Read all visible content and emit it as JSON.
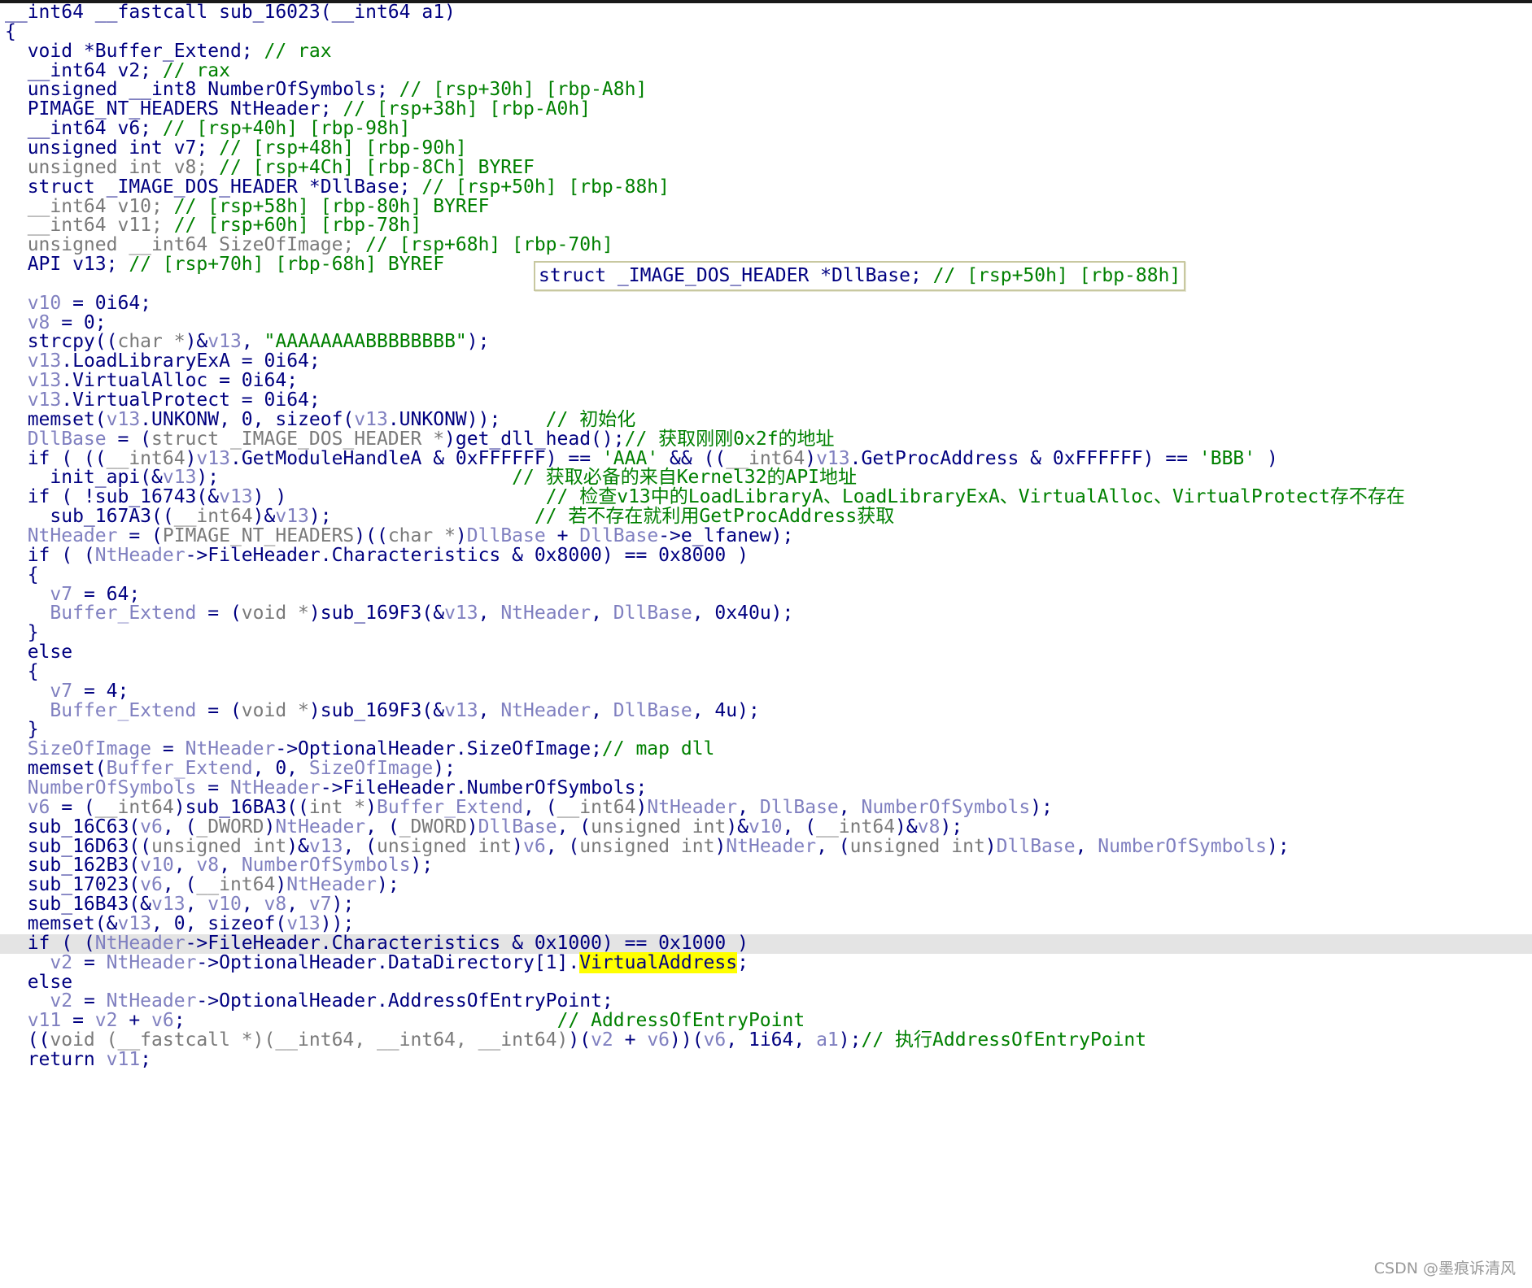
{
  "editor": {
    "current_line_index": 48,
    "lines": [
      [
        [
          "k",
          "__int64 __fastcall sub_16023(__int64 a1)"
        ]
      ],
      [
        [
          "p",
          "{"
        ]
      ],
      [
        [
          "k",
          "  void *Buffer_Extend; "
        ],
        [
          "c",
          "// rax"
        ]
      ],
      [
        [
          "k",
          "  __int64 v2; "
        ],
        [
          "c",
          "// rax"
        ]
      ],
      [
        [
          "k",
          "  unsigned __int8 NumberOfSymbols; "
        ],
        [
          "c",
          "// [rsp+30h] [rbp-A8h]"
        ]
      ],
      [
        [
          "k",
          "  PIMAGE_NT_HEADERS NtHeader; "
        ],
        [
          "c",
          "// [rsp+38h] [rbp-A0h]"
        ]
      ],
      [
        [
          "k",
          "  __int64 v6; "
        ],
        [
          "c",
          "// [rsp+40h] [rbp-98h]"
        ]
      ],
      [
        [
          "k",
          "  unsigned int v7; "
        ],
        [
          "c",
          "// [rsp+48h] [rbp-90h]"
        ]
      ],
      [
        [
          "t",
          "  unsigned int v8; "
        ],
        [
          "c",
          "// [rsp+4Ch] [rbp-8Ch] BYREF"
        ]
      ],
      [
        [
          "k",
          "  struct _IMAGE_DOS_HEADER *DllBase; "
        ],
        [
          "c",
          "// [rsp+50h] [rbp-88h]"
        ]
      ],
      [
        [
          "t",
          "  __int64 v10; "
        ],
        [
          "c",
          "// [rsp+58h] [rbp-80h] BYREF"
        ]
      ],
      [
        [
          "t",
          "  __int64 v11; "
        ],
        [
          "c",
          "// [rsp+60h] [rbp-78h]"
        ]
      ],
      [
        [
          "t",
          "  unsigned __int64 SizeOfImage; "
        ],
        [
          "c",
          "// [rsp+68h] [rbp-70h]"
        ]
      ],
      [
        [
          "k",
          "  API v13; "
        ],
        [
          "c",
          "// [rsp+70h] [rbp-68h] BYREF"
        ]
      ],
      [],
      [
        [
          "v",
          "  v10"
        ],
        [
          "p",
          " = 0i64;"
        ]
      ],
      [
        [
          "v",
          "  v8"
        ],
        [
          "p",
          " = 0;"
        ]
      ],
      [
        [
          "n",
          "  strcpy(("
        ],
        [
          "t",
          "char *"
        ],
        [
          "p",
          ")&"
        ],
        [
          "v",
          "v13"
        ],
        [
          "p",
          ", "
        ],
        [
          "s",
          "\"AAAAAAAABBBBBBBB\""
        ],
        [
          "p",
          ");"
        ]
      ],
      [
        [
          "v",
          "  v13"
        ],
        [
          "p",
          ".LoadLibraryExA = 0i64;"
        ]
      ],
      [
        [
          "v",
          "  v13"
        ],
        [
          "p",
          ".VirtualAlloc = 0i64;"
        ]
      ],
      [
        [
          "v",
          "  v13"
        ],
        [
          "p",
          ".VirtualProtect = 0i64;"
        ]
      ],
      [
        [
          "n",
          "  memset("
        ],
        [
          "v",
          "v13"
        ],
        [
          "p",
          ".UNKONW, 0, sizeof("
        ],
        [
          "v",
          "v13"
        ],
        [
          "p",
          ".UNKONW));    "
        ],
        [
          "c",
          "// 初始化"
        ]
      ],
      [
        [
          "v",
          "  DllBase"
        ],
        [
          "p",
          " = ("
        ],
        [
          "t",
          "struct _IMAGE_DOS_HEADER *"
        ],
        [
          "p",
          ")get_dll_head();"
        ],
        [
          "c",
          "// 获取刚刚0x2f的地址"
        ]
      ],
      [
        [
          "k",
          "  if ( (("
        ],
        [
          "t",
          "__int64"
        ],
        [
          "p",
          ")"
        ],
        [
          "v",
          "v13"
        ],
        [
          "p",
          ".GetModuleHandleA & 0xFFFFFF) == "
        ],
        [
          "s",
          "'AAA'"
        ],
        [
          "p",
          " && (("
        ],
        [
          "t",
          "__int64"
        ],
        [
          "p",
          ")"
        ],
        [
          "v",
          "v13"
        ],
        [
          "p",
          ".GetProcAddress & 0xFFFFFF) == "
        ],
        [
          "s",
          "'BBB'"
        ],
        [
          "p",
          " )"
        ]
      ],
      [
        [
          "n",
          "    init_api(&"
        ],
        [
          "v",
          "v13"
        ],
        [
          "p",
          ");                          "
        ],
        [
          "c",
          "// 获取必备的来自Kernel32的API地址"
        ]
      ],
      [
        [
          "k",
          "  if ( !sub_16743(&"
        ],
        [
          "v",
          "v13"
        ],
        [
          "p",
          ") )                       "
        ],
        [
          "c",
          "// 检查v13中的LoadLibraryA、LoadLibraryExA、VirtualAlloc、VirtualProtect存不存在"
        ]
      ],
      [
        [
          "n",
          "    sub_167A3(("
        ],
        [
          "t",
          "__int64"
        ],
        [
          "p",
          ")&"
        ],
        [
          "v",
          "v13"
        ],
        [
          "p",
          ");                  "
        ],
        [
          "c",
          "// 若不存在就利用GetProcAddress获取"
        ]
      ],
      [
        [
          "v",
          "  NtHeader"
        ],
        [
          "p",
          " = ("
        ],
        [
          "t",
          "PIMAGE_NT_HEADERS"
        ],
        [
          "p",
          ")(("
        ],
        [
          "t",
          "char *"
        ],
        [
          "p",
          ")"
        ],
        [
          "v",
          "DllBase"
        ],
        [
          "p",
          " + "
        ],
        [
          "v",
          "DllBase"
        ],
        [
          "p",
          "->e_lfanew);"
        ]
      ],
      [
        [
          "k",
          "  if ( ("
        ],
        [
          "v",
          "NtHeader"
        ],
        [
          "p",
          "->FileHeader.Characteristics & 0x8000) == 0x8000 )"
        ]
      ],
      [
        [
          "p",
          "  {"
        ]
      ],
      [
        [
          "v",
          "    v7"
        ],
        [
          "p",
          " = 64;"
        ]
      ],
      [
        [
          "v",
          "    Buffer_Extend"
        ],
        [
          "p",
          " = ("
        ],
        [
          "t",
          "void *"
        ],
        [
          "p",
          ")sub_169F3(&"
        ],
        [
          "v",
          "v13"
        ],
        [
          "p",
          ", "
        ],
        [
          "v",
          "NtHeader"
        ],
        [
          "p",
          ", "
        ],
        [
          "v",
          "DllBase"
        ],
        [
          "p",
          ", 0x40u);"
        ]
      ],
      [
        [
          "p",
          "  }"
        ]
      ],
      [
        [
          "k",
          "  else"
        ]
      ],
      [
        [
          "p",
          "  {"
        ]
      ],
      [
        [
          "v",
          "    v7"
        ],
        [
          "p",
          " = 4;"
        ]
      ],
      [
        [
          "v",
          "    Buffer_Extend"
        ],
        [
          "p",
          " = ("
        ],
        [
          "t",
          "void *"
        ],
        [
          "p",
          ")sub_169F3(&"
        ],
        [
          "v",
          "v13"
        ],
        [
          "p",
          ", "
        ],
        [
          "v",
          "NtHeader"
        ],
        [
          "p",
          ", "
        ],
        [
          "v",
          "DllBase"
        ],
        [
          "p",
          ", 4u);"
        ]
      ],
      [
        [
          "p",
          "  }"
        ]
      ],
      [
        [
          "v",
          "  SizeOfImage"
        ],
        [
          "p",
          " = "
        ],
        [
          "v",
          "NtHeader"
        ],
        [
          "p",
          "->OptionalHeader.SizeOfImage;"
        ],
        [
          "c",
          "// map dll"
        ]
      ],
      [
        [
          "n",
          "  memset("
        ],
        [
          "v",
          "Buffer_Extend"
        ],
        [
          "p",
          ", 0, "
        ],
        [
          "v",
          "SizeOfImage"
        ],
        [
          "p",
          ");"
        ]
      ],
      [
        [
          "v",
          "  NumberOfSymbols"
        ],
        [
          "p",
          " = "
        ],
        [
          "v",
          "NtHeader"
        ],
        [
          "p",
          "->FileHeader.NumberOfSymbols;"
        ]
      ],
      [
        [
          "v",
          "  v6"
        ],
        [
          "p",
          " = ("
        ],
        [
          "t",
          "__int64"
        ],
        [
          "p",
          ")sub_16BA3(("
        ],
        [
          "t",
          "int *"
        ],
        [
          "p",
          ")"
        ],
        [
          "v",
          "Buffer_Extend"
        ],
        [
          "p",
          ", ("
        ],
        [
          "t",
          "__int64"
        ],
        [
          "p",
          ")"
        ],
        [
          "v",
          "NtHeader"
        ],
        [
          "p",
          ", "
        ],
        [
          "v",
          "DllBase"
        ],
        [
          "p",
          ", "
        ],
        [
          "v",
          "NumberOfSymbols"
        ],
        [
          "p",
          ");"
        ]
      ],
      [
        [
          "n",
          "  sub_16C63("
        ],
        [
          "v",
          "v6"
        ],
        [
          "p",
          ", ("
        ],
        [
          "t",
          "_DWORD"
        ],
        [
          "p",
          ")"
        ],
        [
          "v",
          "NtHeader"
        ],
        [
          "p",
          ", ("
        ],
        [
          "t",
          "_DWORD"
        ],
        [
          "p",
          ")"
        ],
        [
          "v",
          "DllBase"
        ],
        [
          "p",
          ", ("
        ],
        [
          "t",
          "unsigned int"
        ],
        [
          "p",
          ")&"
        ],
        [
          "v",
          "v10"
        ],
        [
          "p",
          ", ("
        ],
        [
          "t",
          "__int64"
        ],
        [
          "p",
          ")&"
        ],
        [
          "v",
          "v8"
        ],
        [
          "p",
          ");"
        ]
      ],
      [
        [
          "n",
          "  sub_16D63(("
        ],
        [
          "t",
          "unsigned int"
        ],
        [
          "p",
          ")&"
        ],
        [
          "v",
          "v13"
        ],
        [
          "p",
          ", ("
        ],
        [
          "t",
          "unsigned int"
        ],
        [
          "p",
          ")"
        ],
        [
          "v",
          "v6"
        ],
        [
          "p",
          ", ("
        ],
        [
          "t",
          "unsigned int"
        ],
        [
          "p",
          ")"
        ],
        [
          "v",
          "NtHeader"
        ],
        [
          "p",
          ", ("
        ],
        [
          "t",
          "unsigned int"
        ],
        [
          "p",
          ")"
        ],
        [
          "v",
          "DllBase"
        ],
        [
          "p",
          ", "
        ],
        [
          "v",
          "NumberOfSymbols"
        ],
        [
          "p",
          ");"
        ]
      ],
      [
        [
          "n",
          "  sub_162B3("
        ],
        [
          "v",
          "v10"
        ],
        [
          "p",
          ", "
        ],
        [
          "v",
          "v8"
        ],
        [
          "p",
          ", "
        ],
        [
          "v",
          "NumberOfSymbols"
        ],
        [
          "p",
          ");"
        ]
      ],
      [
        [
          "n",
          "  sub_17023("
        ],
        [
          "v",
          "v6"
        ],
        [
          "p",
          ", ("
        ],
        [
          "t",
          "__int64"
        ],
        [
          "p",
          ")"
        ],
        [
          "v",
          "NtHeader"
        ],
        [
          "p",
          ");"
        ]
      ],
      [
        [
          "n",
          "  sub_16B43(&"
        ],
        [
          "v",
          "v13"
        ],
        [
          "p",
          ", "
        ],
        [
          "v",
          "v10"
        ],
        [
          "p",
          ", "
        ],
        [
          "v",
          "v8"
        ],
        [
          "p",
          ", "
        ],
        [
          "v",
          "v7"
        ],
        [
          "p",
          ");"
        ]
      ],
      [
        [
          "n",
          "  memset(&"
        ],
        [
          "v",
          "v13"
        ],
        [
          "p",
          ", 0, sizeof("
        ],
        [
          "v",
          "v13"
        ],
        [
          "p",
          "));"
        ]
      ],
      [
        [
          "k",
          "  if ( ("
        ],
        [
          "v",
          "NtHeader"
        ],
        [
          "p",
          "->FileHeader.Characteristics & 0x1000) == 0x1000 )"
        ]
      ],
      [
        [
          "v",
          "    v2"
        ],
        [
          "p",
          " = "
        ],
        [
          "v",
          "NtHeader"
        ],
        [
          "p",
          "->OptionalHeader.DataDirectory[1]."
        ],
        [
          "h",
          "VirtualAddress"
        ],
        [
          "p",
          ";"
        ]
      ],
      [
        [
          "k",
          "  else"
        ]
      ],
      [
        [
          "v",
          "    v2"
        ],
        [
          "p",
          " = "
        ],
        [
          "v",
          "NtHeader"
        ],
        [
          "p",
          "->OptionalHeader.AddressOfEntryPoint;"
        ]
      ],
      [
        [
          "v",
          "  v11"
        ],
        [
          "p",
          " = "
        ],
        [
          "v",
          "v2"
        ],
        [
          "p",
          " + "
        ],
        [
          "v",
          "v6"
        ],
        [
          "p",
          ";                                 "
        ],
        [
          "c",
          "// AddressOfEntryPoint"
        ]
      ],
      [
        [
          "p",
          "  (("
        ],
        [
          "t",
          "void (__fastcall *)(__int64, __int64, __int64)"
        ],
        [
          "p",
          ")("
        ],
        [
          "v",
          "v2"
        ],
        [
          "p",
          " + "
        ],
        [
          "v",
          "v6"
        ],
        [
          "p",
          "))("
        ],
        [
          "v",
          "v6"
        ],
        [
          "p",
          ", 1i64, "
        ],
        [
          "v",
          "a1"
        ],
        [
          "p",
          ");"
        ],
        [
          "c",
          "// 执行AddressOfEntryPoint"
        ]
      ],
      [
        [
          "k",
          "  return "
        ],
        [
          "v",
          "v11"
        ],
        [
          "p",
          ";"
        ]
      ]
    ]
  },
  "tooltip": {
    "segments": [
      [
        "k",
        "struct _IMAGE_DOS_HEADER *DllBase; "
      ],
      [
        "c",
        "// [rsp+50h] [rbp-88h]"
      ]
    ]
  },
  "watermark": "CSDN @墨痕诉清风"
}
